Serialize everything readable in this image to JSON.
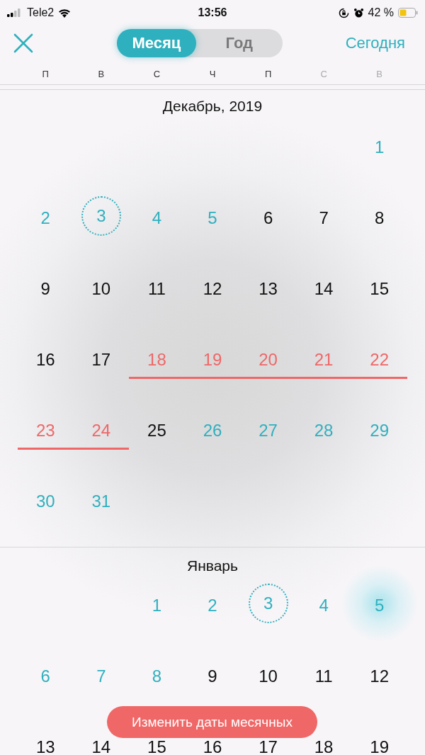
{
  "status_bar": {
    "carrier": "Tele2",
    "time": "13:56",
    "battery": "42 %"
  },
  "nav": {
    "segments": [
      {
        "label": "Месяц",
        "selected": true
      },
      {
        "label": "Год",
        "selected": false
      }
    ],
    "today_link": "Сегодня"
  },
  "weekdays": [
    {
      "label": "П",
      "weekend": false
    },
    {
      "label": "В",
      "weekend": false
    },
    {
      "label": "С",
      "weekend": false
    },
    {
      "label": "Ч",
      "weekend": false
    },
    {
      "label": "П",
      "weekend": false
    },
    {
      "label": "С",
      "weekend": true
    },
    {
      "label": "В",
      "weekend": true
    }
  ],
  "months": [
    {
      "title": "Декабрь, 2019",
      "weeks": [
        {
          "kind": "opening",
          "days": [
            {
              "day": "1",
              "kind": "highlight",
              "today": false
            }
          ]
        },
        {
          "kind": "full",
          "days": [
            {
              "day": "2",
              "kind": "highlight",
              "today": false
            },
            {
              "day": "3",
              "kind": "highlight",
              "today": true
            },
            {
              "day": "4",
              "kind": "highlight",
              "today": false
            },
            {
              "day": "5",
              "kind": "highlight",
              "today": false
            },
            {
              "day": "6",
              "kind": "plain",
              "today": false
            },
            {
              "day": "7",
              "kind": "plain",
              "today": false
            },
            {
              "day": "8",
              "kind": "plain",
              "today": false
            }
          ]
        },
        {
          "kind": "full",
          "days": [
            {
              "day": "9",
              "kind": "plain",
              "today": false
            },
            {
              "day": "10",
              "kind": "plain",
              "today": false
            },
            {
              "day": "11",
              "kind": "plain",
              "today": false
            },
            {
              "day": "12",
              "kind": "plain",
              "today": false
            },
            {
              "day": "13",
              "kind": "plain",
              "today": false
            },
            {
              "day": "14",
              "kind": "plain",
              "today": false
            },
            {
              "day": "15",
              "kind": "plain",
              "today": false
            }
          ]
        },
        {
          "kind": "full",
          "days": [
            {
              "day": "16",
              "kind": "plain",
              "today": false
            },
            {
              "day": "17",
              "kind": "plain",
              "today": false
            },
            {
              "day": "18",
              "kind": "period",
              "today": false
            },
            {
              "day": "19",
              "kind": "period",
              "today": false
            },
            {
              "day": "20",
              "kind": "period",
              "today": false
            },
            {
              "day": "21",
              "kind": "period",
              "today": false
            },
            {
              "day": "22",
              "kind": "period",
              "today": false
            }
          ]
        },
        {
          "kind": "full",
          "days": [
            {
              "day": "23",
              "kind": "period",
              "today": false
            },
            {
              "day": "24",
              "kind": "period",
              "today": false
            },
            {
              "day": "25",
              "kind": "plain",
              "today": false
            },
            {
              "day": "26",
              "kind": "highlight",
              "today": false
            },
            {
              "day": "27",
              "kind": "highlight",
              "today": false
            },
            {
              "day": "28",
              "kind": "highlight",
              "today": false
            },
            {
              "day": "29",
              "kind": "highlight",
              "today": false
            }
          ]
        },
        {
          "kind": "closing",
          "days": [
            {
              "day": "30",
              "kind": "highlight",
              "today": false
            },
            {
              "day": "31",
              "kind": "highlight",
              "today": false
            }
          ]
        }
      ]
    },
    {
      "title": "Январь",
      "weeks": [
        {
          "kind": "opening",
          "days": [
            {
              "day": "1",
              "kind": "highlight",
              "today": false
            },
            {
              "day": "2",
              "kind": "highlight",
              "today": false
            },
            {
              "day": "3",
              "kind": "highlight",
              "today": true
            },
            {
              "day": "4",
              "kind": "highlight",
              "today": false
            },
            {
              "day": "5",
              "kind": "peak",
              "today": false
            }
          ]
        },
        {
          "kind": "full",
          "days": [
            {
              "day": "6",
              "kind": "highlight",
              "today": false
            },
            {
              "day": "7",
              "kind": "highlight",
              "today": false
            },
            {
              "day": "8",
              "kind": "highlight",
              "today": false
            },
            {
              "day": "9",
              "kind": "plain",
              "today": false
            },
            {
              "day": "10",
              "kind": "plain",
              "today": false
            },
            {
              "day": "11",
              "kind": "plain",
              "today": false
            },
            {
              "day": "12",
              "kind": "plain",
              "today": false
            }
          ]
        },
        {
          "kind": "full",
          "days": [
            {
              "day": "13",
              "kind": "plain",
              "today": false
            },
            {
              "day": "14",
              "kind": "plain",
              "today": false
            },
            {
              "day": "15",
              "kind": "plain",
              "today": false
            },
            {
              "day": "16",
              "kind": "plain",
              "today": false
            },
            {
              "day": "17",
              "kind": "plain",
              "today": false
            },
            {
              "day": "18",
              "kind": "plain",
              "today": false
            },
            {
              "day": "19",
              "kind": "plain",
              "today": false
            }
          ]
        }
      ]
    }
  ],
  "action_button": "Изменить даты месячных"
}
